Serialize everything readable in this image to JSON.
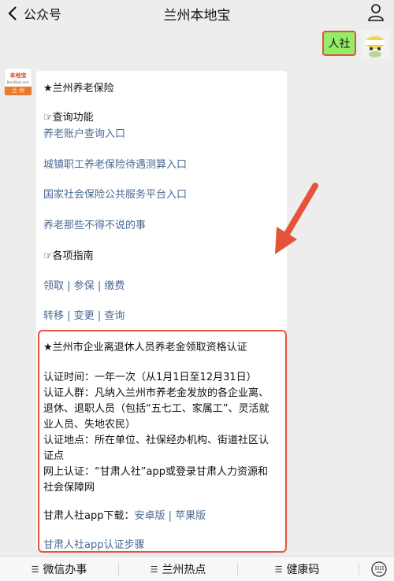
{
  "topbar": {
    "back_label": "公众号",
    "title": "兰州本地宝"
  },
  "outgoing": {
    "text": "人社"
  },
  "sender": {
    "logo_top": "本地宝",
    "logo_url": "Bendibao.com",
    "logo_city": "兰 州"
  },
  "message": {
    "heading": "★兰州养老保险",
    "query_heading": "☞查询功能",
    "links": [
      "养老账户查询入口",
      "城镇职工养老保险待遇测算入口",
      "国家社会保险公共服务平台入口",
      "养老那些不得不说的事"
    ],
    "guide_heading": "☞各项指南",
    "guide_row1": [
      "领取",
      "参保",
      "缴费"
    ],
    "guide_row2": [
      "转移",
      "变更",
      "查询"
    ],
    "separator": " | ",
    "cert_heading": "★兰州市企业离退休人员养老金领取资格认证",
    "cert_lines": [
      "认证时间：一年一次（从1月1日至12月31日）",
      "认证人群：凡纳入兰州市养老金发放的各企业离、",
      "退休、退职人员（包括“五七工、家属工”、灵活就",
      "业人员、失地农民）",
      "认证地点：所在单位、社保经办机构、街道社区认",
      "证点",
      "网上认证：“甘肃人社”app或登录甘肃人力资源和",
      "社会保障网"
    ],
    "app_download_label": "甘肃人社app下载：",
    "app_android": "安卓版",
    "app_ios": "苹果版",
    "app_steps": "甘肃人社app认证步骤"
  },
  "bottom_menu": {
    "items": [
      "微信办事",
      "兰州热点",
      "健康码"
    ],
    "glyph": "☰"
  },
  "colors": {
    "background": "#ededed",
    "bubble_green": "#95ec69",
    "link_blue": "#4a6a93",
    "highlight_red": "#e5533b"
  }
}
